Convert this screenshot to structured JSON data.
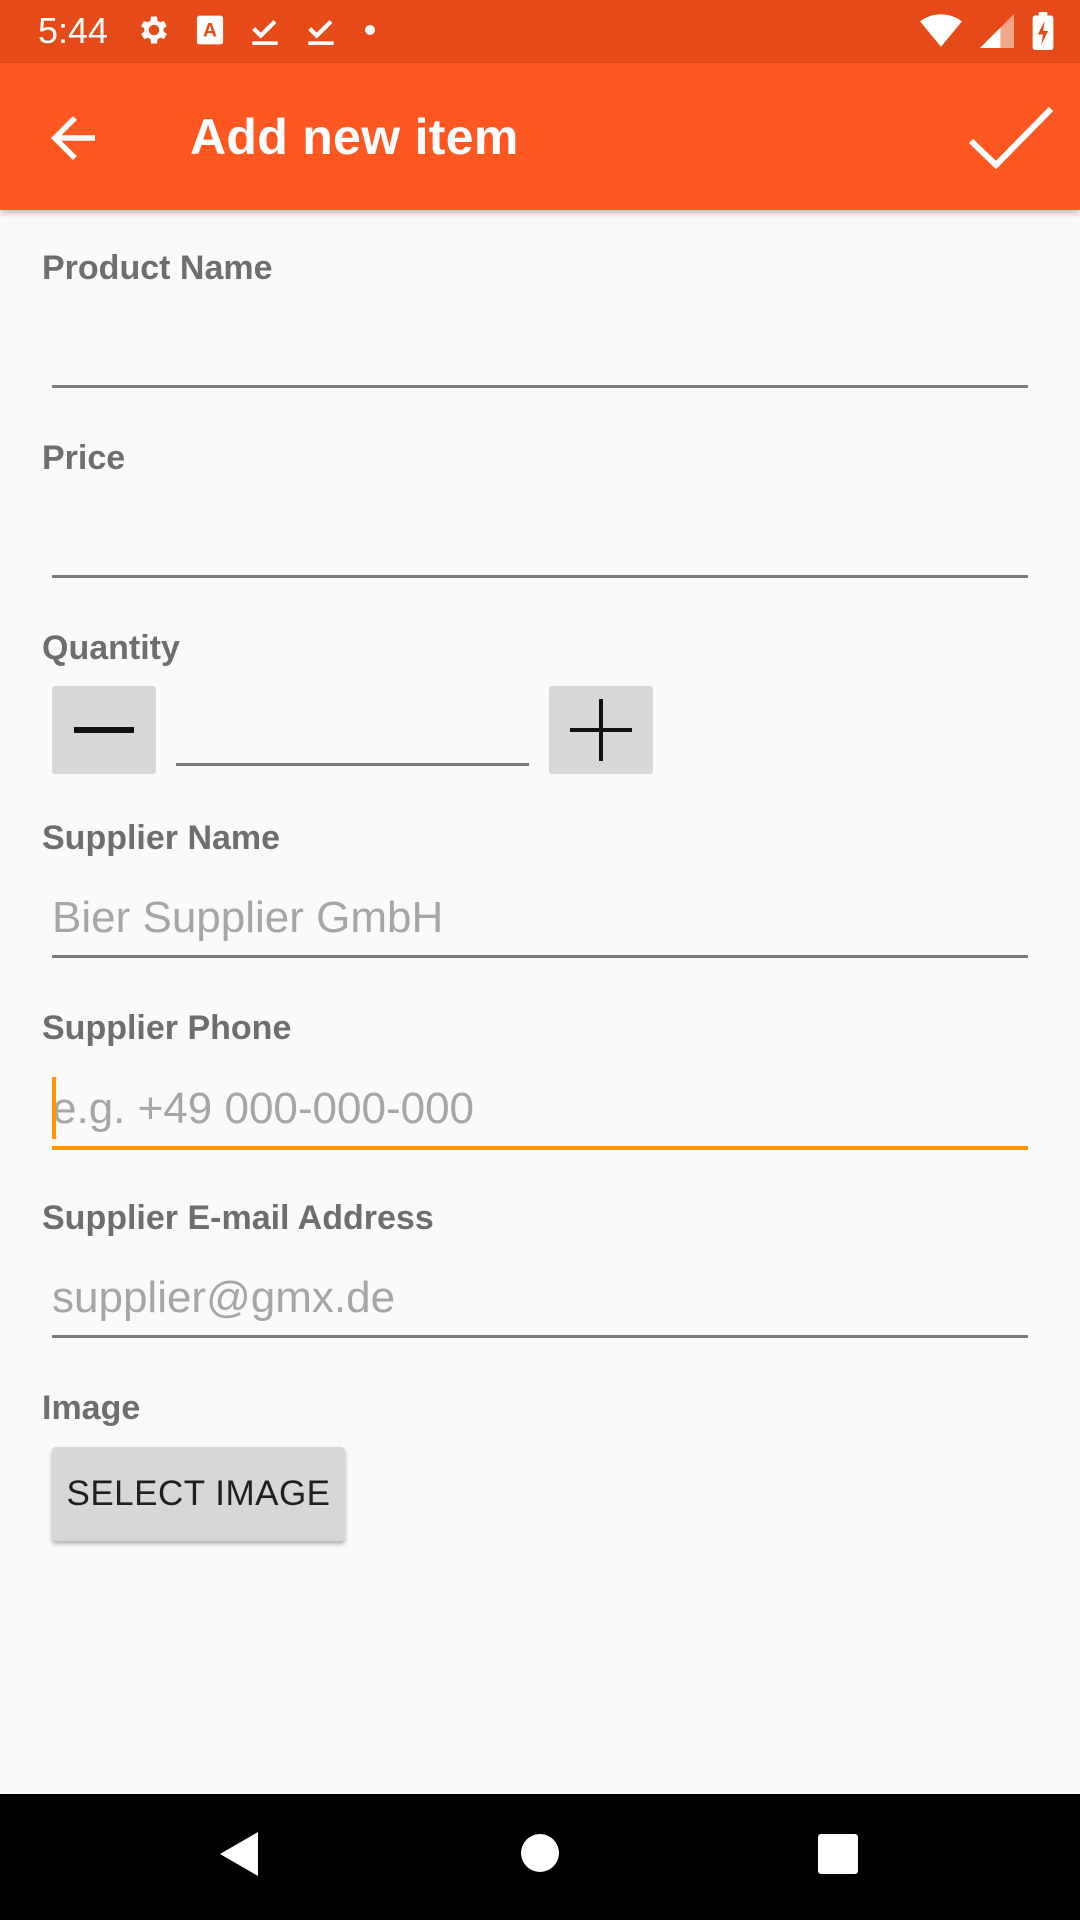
{
  "status_bar": {
    "time": "5:44",
    "left_icons": [
      "gear-icon",
      "a-badge-icon",
      "download-done-icon",
      "download-done-icon",
      "dot-icon"
    ],
    "right_icons": [
      "wifi-icon",
      "signal-icon",
      "battery-charging-icon"
    ],
    "color": "#e64a19"
  },
  "app_bar": {
    "title": "Add new item",
    "back_icon": "arrow-back-icon",
    "save_icon": "check-icon",
    "color": "#ff5722"
  },
  "form": {
    "product_name": {
      "label": "Product Name",
      "value": "",
      "placeholder": ""
    },
    "price": {
      "label": "Price",
      "value": "",
      "placeholder": ""
    },
    "quantity": {
      "label": "Quantity",
      "value": "",
      "decrement_icon": "minus-icon",
      "increment_icon": "plus-icon"
    },
    "supplier_name": {
      "label": "Supplier Name",
      "value": "",
      "placeholder": "Bier Supplier GmbH"
    },
    "supplier_phone": {
      "label": "Supplier Phone",
      "value": "",
      "placeholder": "e.g. +49 000-000-000",
      "focused": true
    },
    "supplier_email": {
      "label": "Supplier E-mail Address",
      "value": "",
      "placeholder": "supplier@gmx.de"
    },
    "image": {
      "label": "Image",
      "button_label": "SELECT IMAGE"
    }
  },
  "accent_color": "#ff9800",
  "nav_bar": {
    "icons": [
      "nav-back-icon",
      "nav-home-icon",
      "nav-recents-icon"
    ]
  }
}
